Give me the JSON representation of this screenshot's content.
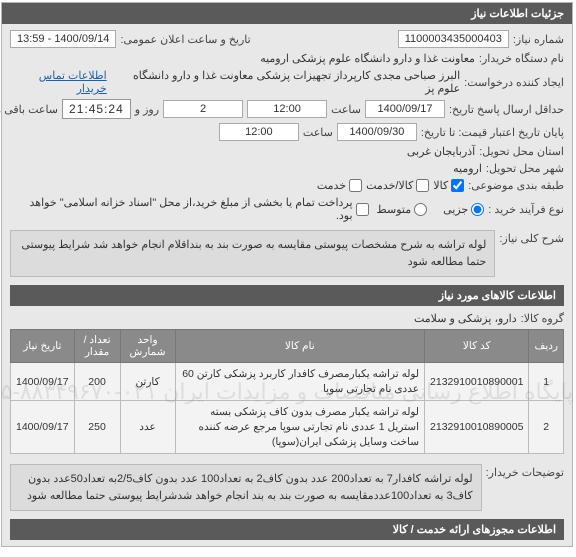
{
  "panel_title": "جزئیات اطلاعات نیاز",
  "fields": {
    "need_number_label": "شماره نیاز:",
    "need_number": "1100003435000403",
    "announce_label": "تاریخ و ساعت اعلان عمومی:",
    "announce_value": "1400/09/14 - 13:59",
    "buyer_org_label": "نام دستگاه خریدار:",
    "buyer_org": "معاونت غذا و دارو دانشگاه علوم پزشکی ارومیه",
    "requester_label": "ایجاد کننده درخواست:",
    "requester": "البرز صباحی مجدی کارپرداز تجهیزات پزشکی معاونت غذا و دارو دانشگاه علوم پز",
    "contact_link": "اطلاعات تماس خریدار",
    "min_send_label": "حداقل ارسال پاسخ تاریخ:",
    "min_send_date": "1400/09/17",
    "time_label": "ساعت",
    "min_send_time": "12:00",
    "day_and": "روز و",
    "days": "2",
    "remaining": "ساعت باقی مانده",
    "countdown": "21:45:24",
    "credit_end_label": "پایان تاریخ اعتبار قیمت: تا تاریخ:",
    "credit_end_date": "1400/09/30",
    "credit_end_time": "12:00",
    "province_label": "استان محل تحویل:",
    "province": "آذربایجان غربی",
    "city_label": "شهر محل تحویل:",
    "city": "ارومیه",
    "topic_group_label": "طبقه بندی موضوعی:",
    "topic_kala": "کالا",
    "topic_service": "کالا/خدمت",
    "topic_khadamat": "خدمت",
    "process_type_label": "نوع فرآیند خرید :",
    "process_radio1": "جزیی",
    "process_radio2": "متوسط",
    "pay_note": "پرداخت تمام یا بخشی از مبلغ خرید،از محل \"اسناد خزانه اسلامی\" خواهد بود."
  },
  "general_desc": {
    "label": "شرح کلی نیاز:",
    "text": "لوله تراشه به شرح مشخصات پیوستی مقایسه به صورت بند به بنداقلام انجام خواهد شد شرایط پیوستی حتما مطالعه شود"
  },
  "items_section_title": "اطلاعات کالاهای مورد نیاز",
  "goods_group_label": "گروه کالا:",
  "goods_group": "دارو، پزشکی و سلامت",
  "watermark_text": "پایگاه اطلاع رسانی مناقصات و مزایدات ایران ۰۲۱-۸۸۳۴۹۶۷۰-۵",
  "table": {
    "headers": {
      "row": "ردیف",
      "code": "کد کالا",
      "name": "نام کالا",
      "unit": "واحد شمارش",
      "qty": "تعداد / مقدار",
      "date": "تاریخ نیاز"
    },
    "rows": [
      {
        "row": "1",
        "code": "2132910010890001",
        "name": "لوله تراشه یکبارمصرف کافدار کاربرد پزشکی کارتن 60 عددی نام تجارتی سوپا",
        "unit": "کارتن",
        "qty": "200",
        "date": "1400/09/17"
      },
      {
        "row": "2",
        "code": "2132910010890005",
        "name": "لوله تراشه یکبار مصرف بدون کاف پزشکی بسته استریل 1 عددی نام تجارتی سوپا مرجع عرضه کننده ساخت وسایل پزشکی ایران(سوپا)",
        "unit": "عدد",
        "qty": "250",
        "date": "1400/09/17"
      }
    ]
  },
  "buyer_notes": {
    "label": "توضیحات خریدار:",
    "text": "لوله تراشه کافدار7 به تعداد200 عدد بدون کاف2 به تعداد100 عدد بدون کاف2/5به تعداد50عدد بدون کاف3 به تعداد100عددمقایسه به صورت بند به بند انجام خواهد شدشرایط پیوستی حتما مطالعه شود"
  },
  "permits_title": "اطلاعات مجوزهای ارائه خدمت / کالا"
}
